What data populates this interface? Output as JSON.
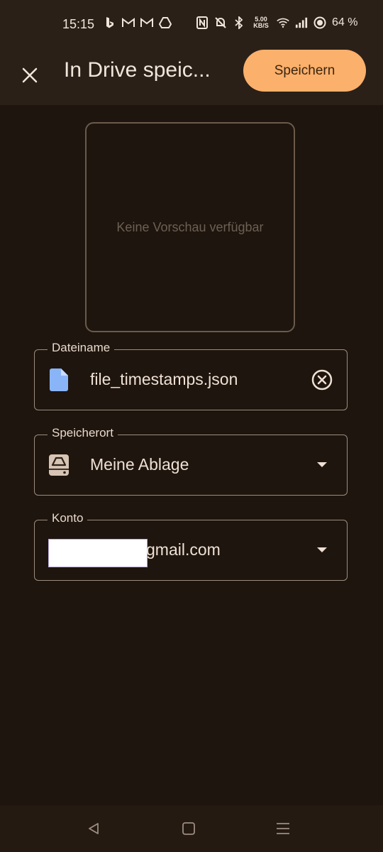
{
  "status_bar": {
    "time": "15:15",
    "left_icons": [
      "bing-icon",
      "gmail-icon",
      "gmail-icon",
      "drive-icon"
    ],
    "right_icons": [
      "nfc-icon",
      "mute-icon",
      "bluetooth-icon"
    ],
    "net_speed_value": "5.00",
    "net_speed_unit": "KB/S",
    "battery": "64 %"
  },
  "app_bar": {
    "title": "In Drive speic...",
    "save_label": "Speichern"
  },
  "preview": {
    "placeholder": "Keine Vorschau verfügbar"
  },
  "fields": {
    "filename": {
      "label": "Dateiname",
      "value": "file_timestamps.json",
      "icon": "file-icon"
    },
    "location": {
      "label": "Speicherort",
      "value": "Meine Ablage",
      "icon": "drive-storage-icon"
    },
    "account": {
      "label": "Konto",
      "value_suffix": "gmail.com"
    }
  },
  "colors": {
    "background": "#1e150e",
    "app_bar": "#2a2018",
    "accent": "#fbb06b",
    "file_icon": "#8ab4f8"
  }
}
